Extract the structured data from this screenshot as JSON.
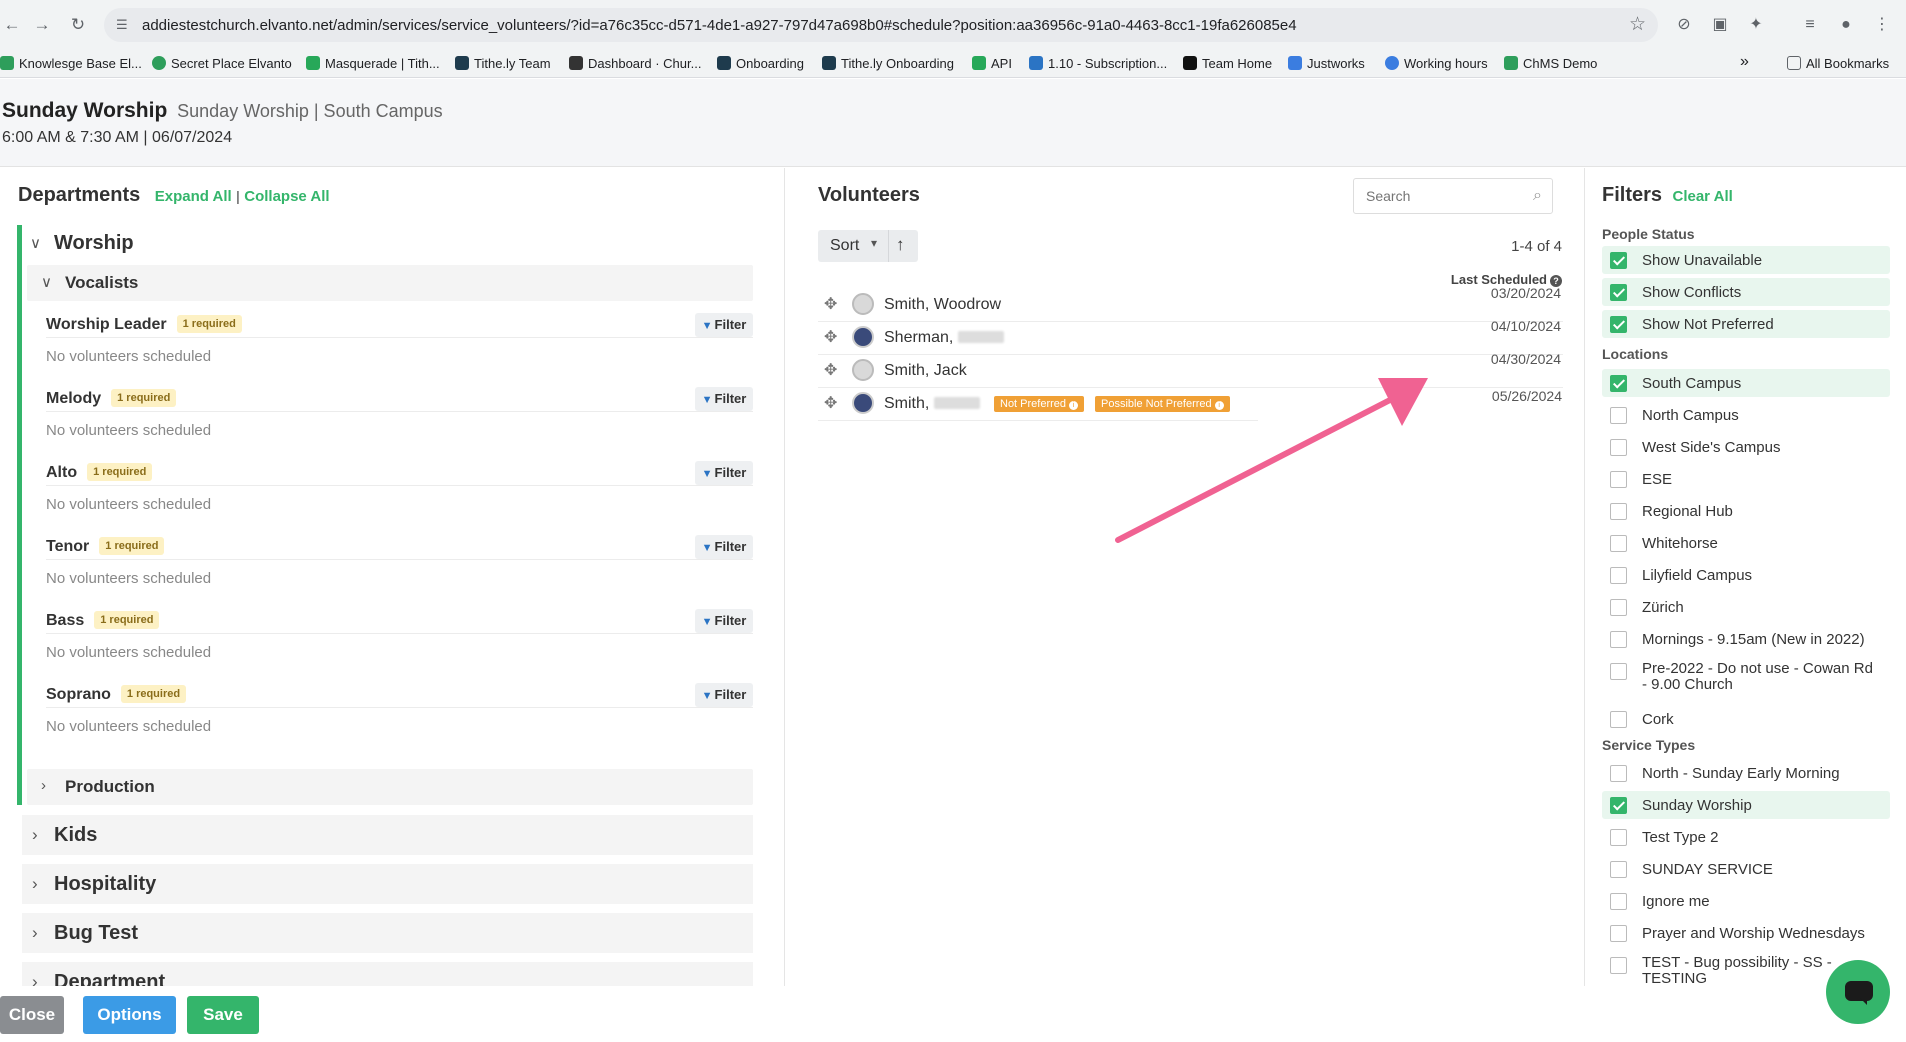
{
  "browser": {
    "url": "addiestestchurch.elvanto.net/admin/services/service_volunteers/?id=a76c35cc-d571-4de1-a927-797d47a698b0#schedule?position:aa36956c-91a0-4463-8cc1-19fa626085e4",
    "bookmarks": [
      "Knowlesge Base El...",
      "Secret Place Elvanto",
      "Masquerade | Tith...",
      "Tithe.ly Team",
      "Dashboard · Chur...",
      "Onboarding",
      "Tithe.ly Onboarding",
      "API",
      "1.10 - Subscription...",
      "Team Home",
      "Justworks",
      "Working hours",
      "ChMS Demo"
    ],
    "all_bookmarks": "All Bookmarks",
    "more": "»"
  },
  "header": {
    "title": "Sunday Worship",
    "subtitle": "Sunday Worship | South Campus",
    "datetime": "6:00 AM & 7:30 AM | 06/07/2024"
  },
  "departments": {
    "heading": "Departments",
    "expand_all": "Expand All",
    "separator": "|",
    "collapse_all": "Collapse All",
    "worship": "Worship",
    "vocalists": "Vocalists",
    "filter_label": "Filter",
    "none_text": "No volunteers scheduled",
    "positions": [
      {
        "name": "Worship Leader",
        "badge": "1 required"
      },
      {
        "name": "Melody",
        "badge": "1 required"
      },
      {
        "name": "Alto",
        "badge": "1 required"
      },
      {
        "name": "Tenor",
        "badge": "1 required"
      },
      {
        "name": "Bass",
        "badge": "1 required"
      },
      {
        "name": "Soprano",
        "badge": "1 required"
      }
    ],
    "production": "Production",
    "others": [
      "Kids",
      "Hospitality",
      "Bug Test",
      "Department"
    ]
  },
  "volunteers": {
    "heading": "Volunteers",
    "search_placeholder": "Search",
    "sort_label": "Sort",
    "count": "1-4 of 4",
    "last_scheduled": "Last Scheduled",
    "rows": [
      {
        "name": "Smith, Woodrow",
        "date": "03/20/2024",
        "avatar": "default"
      },
      {
        "name": "Sherman, ",
        "date": "04/10/2024",
        "avatar": "photo"
      },
      {
        "name": "Smith, Jack",
        "date": "04/30/2024",
        "avatar": "default"
      },
      {
        "name": "Smith, ",
        "date": "05/26/2024",
        "avatar": "photo"
      }
    ],
    "tags": [
      "Not Preferred",
      "Possible Not Preferred"
    ]
  },
  "filters": {
    "heading": "Filters",
    "clear_all": "Clear All",
    "people_status_label": "People Status",
    "people_status": [
      {
        "label": "Show Unavailable",
        "checked": true
      },
      {
        "label": "Show Conflicts",
        "checked": true
      },
      {
        "label": "Show Not Preferred",
        "checked": true
      }
    ],
    "locations_label": "Locations",
    "locations": [
      {
        "label": "South Campus",
        "checked": true
      },
      {
        "label": "North Campus",
        "checked": false
      },
      {
        "label": "West Side's Campus",
        "checked": false
      },
      {
        "label": "ESE",
        "checked": false
      },
      {
        "label": "Regional Hub",
        "checked": false
      },
      {
        "label": "Whitehorse",
        "checked": false
      },
      {
        "label": "Lilyfield Campus",
        "checked": false
      },
      {
        "label": "Zürich",
        "checked": false
      },
      {
        "label": "Mornings - 9.15am (New in 2022)",
        "checked": false
      },
      {
        "label": "Pre-2022 - Do not use - Cowan Rd - 9.00 Church",
        "checked": false
      },
      {
        "label": "Cork",
        "checked": false
      }
    ],
    "service_types_label": "Service Types",
    "service_types": [
      {
        "label": "North - Sunday Early Morning",
        "checked": false
      },
      {
        "label": "Sunday Worship",
        "checked": true
      },
      {
        "label": "Test Type 2",
        "checked": false
      },
      {
        "label": "SUNDAY SERVICE",
        "checked": false
      },
      {
        "label": "Ignore me",
        "checked": false
      },
      {
        "label": "Prayer and Worship Wednesdays",
        "checked": false
      },
      {
        "label": "TEST - Bug possibility - SS - TESTING",
        "checked": false
      }
    ]
  },
  "footer": {
    "close": "Close",
    "options": "Options",
    "save": "Save"
  },
  "colors": {
    "accent": "#34b56b",
    "blue": "#3b9be6",
    "gray_btn": "#8a8d91",
    "tag": "#f0a035",
    "annotation_arrow": "#f06292"
  }
}
